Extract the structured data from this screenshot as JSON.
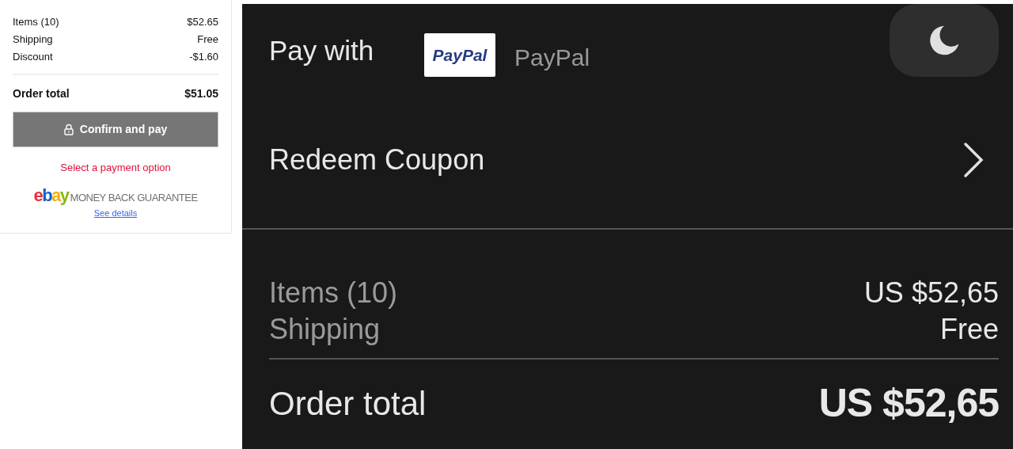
{
  "summary_card": {
    "rows": [
      {
        "label": "Items (10)",
        "value": "$52.65"
      },
      {
        "label": "Shipping",
        "value": "Free"
      },
      {
        "label": "Discount",
        "value": "-$1.60"
      }
    ],
    "total": {
      "label": "Order total",
      "value": "$51.05"
    },
    "confirm_button": {
      "label": "Confirm and pay",
      "disabled": true
    },
    "error": "Select a payment option",
    "guarantee": {
      "logo": "ebay",
      "text": "MONEY BACK GUARANTEE",
      "link": "See details"
    }
  },
  "checkout_panel": {
    "pay_with": {
      "label": "Pay with",
      "logo_text": "PayPal",
      "method": "PayPal"
    },
    "dark_mode": {
      "on": true
    },
    "coupon": "Redeem Coupon",
    "rows": [
      {
        "label": "Items (10)",
        "value": "US $52,65"
      },
      {
        "label": "Shipping",
        "value": "Free"
      }
    ],
    "total": {
      "label": "Order total",
      "value": "US $52,65"
    }
  }
}
